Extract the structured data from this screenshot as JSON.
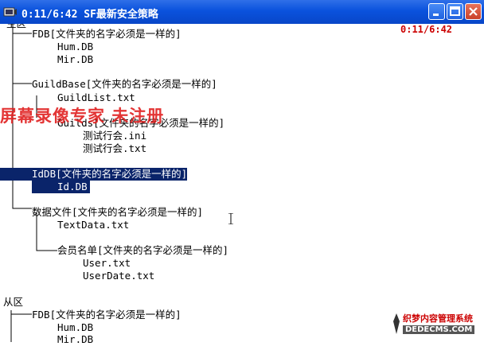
{
  "window": {
    "title": "0:11/6:42 SF最新安全策略",
    "buttons": {
      "minimize": "minimize",
      "maximize": "maximize",
      "close": "close"
    }
  },
  "timer": "0:11/6:42",
  "tree": {
    "top_partial": "主区",
    "fdb": "FDB[文件夹的名字必须是一样的]",
    "fdb_files": [
      "Hum.DB",
      "Mir.DB"
    ],
    "guildbase": "GuildBase[文件夹的名字必须是一样的]",
    "guildlist": "GuildList.txt",
    "guilds": "Guilds[文件夹的名字必须是一样的]",
    "guilds_files": [
      "测试行会.ini",
      "测试行会.txt"
    ],
    "iddb": "IdDB[文件夹的名字必须是一样的]",
    "iddb_file": "Id.DB",
    "datafiles": "数据文件[文件夹的名字必须是一样的]",
    "textdata": "TextData.txt",
    "members": "会员名单[文件夹的名字必须是一样的]",
    "members_files": [
      "User.txt",
      "UserDate.txt"
    ],
    "second_root": "从区",
    "fdb2": "FDB[文件夹的名字必须是一样的]",
    "fdb2_files": [
      "Hum.DB",
      "Mir.DB"
    ]
  },
  "watermark": "屏幕录像专家 未注册",
  "badge": {
    "line1": "织梦内容管理系统",
    "line2": "DEDECMS.COM"
  }
}
